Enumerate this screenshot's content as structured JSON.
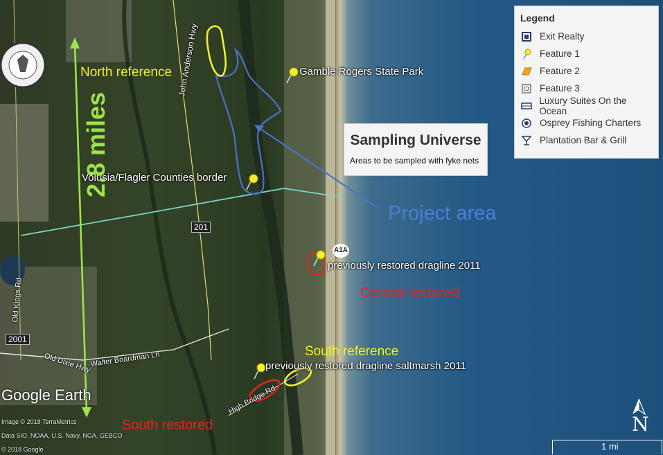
{
  "labels": {
    "north_reference": "North reference",
    "gamble_rogers": "Gamble Rogers State Park",
    "volusia_flagler": "Volusia/Flagler Counties border",
    "project_area": "Project area",
    "previously_restored_2011": "previously restored dragline 2011",
    "central_restored": "Central restored",
    "south_reference": "South reference",
    "previously_restored_saltmarsh": "previously restored dragline saltmarsh 2011",
    "south_restored": "South restored",
    "miles": "2.8 miles"
  },
  "roads": {
    "john_anderson": "John Anderson Hwy",
    "old_kings": "Old Kings Rd",
    "old_dixie": "Old Dixie Hwy",
    "walter_boardman": "Walter Boardman Ln",
    "high_bridge": "High Bridge Rd",
    "route_201": "201",
    "route_2001": "2001",
    "route_a1a": "A1A"
  },
  "info_box": {
    "title": "Sampling Universe",
    "subtitle": "Areas to be sampled with fyke nets"
  },
  "legend": {
    "title": "Legend",
    "items": [
      {
        "label": "Exit Realty",
        "icon": "realty-marker-icon"
      },
      {
        "label": "Feature 1",
        "icon": "yellow-pushpin-icon"
      },
      {
        "label": "Feature 2",
        "icon": "orange-polygon-icon"
      },
      {
        "label": "Feature 3",
        "icon": "square-marker-icon"
      },
      {
        "label": "Luxury Suites On the Ocean",
        "icon": "hotel-icon"
      },
      {
        "label": "Osprey Fishing Charters",
        "icon": "camera-icon"
      },
      {
        "label": "Plantation Bar & Grill",
        "icon": "cocktail-icon"
      }
    ]
  },
  "logo": {
    "name": "FLORIDA FISH AND WILDLIFE CONSERVATION COMMISSION"
  },
  "attribution": {
    "google_earth": "Google Earth",
    "image_credit": "Image © 2018 TerraMetrics",
    "data_credit": "Data SIO, NOAA, U.S. Navy, NGA, GEBCO",
    "copyright": "© 2018 Google"
  },
  "scale_bar": {
    "label": "1 mi"
  },
  "compass": {
    "label": "N"
  },
  "colors": {
    "reference_outline": "#f2f030",
    "restored_outline": "#e0261e",
    "project_outline": "#4a72c8",
    "county_border": "#7ad6c4",
    "distance_arrow": "#9ee34a"
  }
}
